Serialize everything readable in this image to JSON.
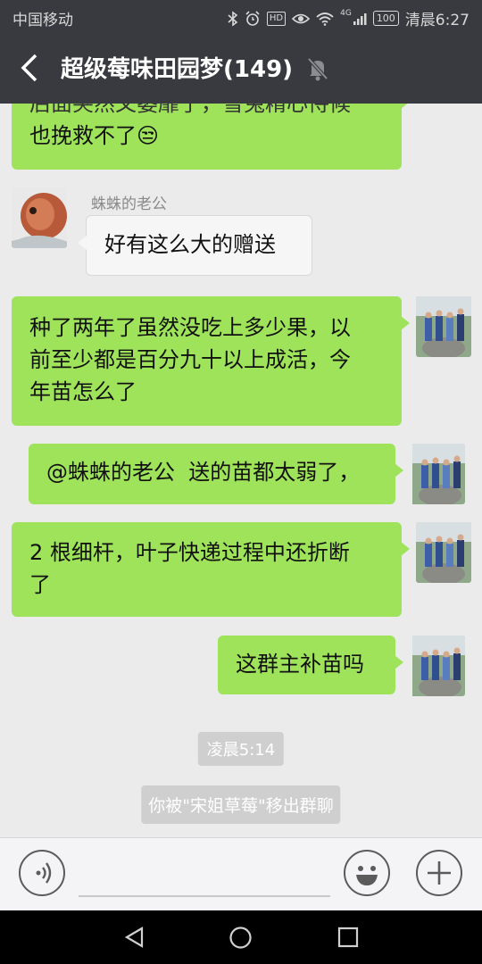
{
  "status_bar": {
    "carrier": "中国移动",
    "hd_badge": "HD",
    "network": "4G",
    "battery": "100",
    "time": "清晨6:27",
    "icons": [
      "bluetooth-icon",
      "alarm-icon",
      "hd-icon",
      "eye-icon",
      "wifi-icon",
      "signal-icon",
      "battery-icon"
    ]
  },
  "header": {
    "title": "超级莓味田园梦(149)",
    "back_icon": "back-arrow-icon",
    "mute_icon": "mute-bell-icon"
  },
  "messages": [
    {
      "from": "me",
      "text": "后面突然又萎靡了，雪兔精心侍候",
      "partially_visible": true
    },
    {
      "from": "me",
      "text": "也挽救不了😒"
    },
    {
      "from": "other",
      "sender": "蛛蛛的老公",
      "text": "好有这么大的赠送"
    },
    {
      "from": "me",
      "line1": "种了两年了虽然没吃上多少果，以",
      "line2": "前至少都是百分九十以上成活，今",
      "line3": "年苗怎么了"
    },
    {
      "from": "me",
      "text": "@蛛蛛的老公  送的苗都太弱了，"
    },
    {
      "from": "me",
      "line1": "2 根细杆，叶子快递过程中还折断",
      "line2": "了"
    },
    {
      "from": "me",
      "text": "这群主补苗吗"
    }
  ],
  "system": {
    "timestamp": "凌晨5:14",
    "notice": "你被\"宋姐草莓\"移出群聊"
  },
  "input_bar": {
    "voice_icon": "voice-icon",
    "emoji_icon": "emoji-icon",
    "plus_icon": "plus-icon"
  },
  "nav_bar": {
    "icons": [
      "nav-back-icon",
      "nav-home-icon",
      "nav-recents-icon"
    ]
  },
  "colors": {
    "header_bg": "#393a3f",
    "chat_bg": "#ebebeb",
    "my_bubble": "#9ee35a",
    "other_bubble": "#f6f6f6"
  }
}
